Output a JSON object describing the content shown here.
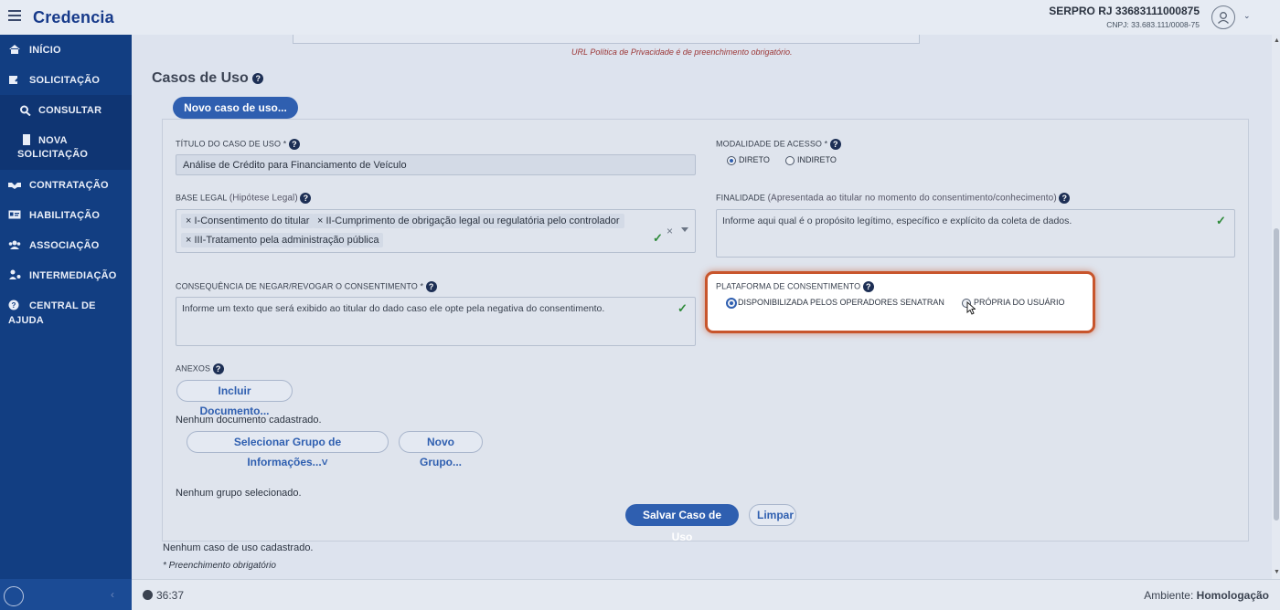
{
  "header": {
    "brand": "Credencia",
    "org_name": "SERPRO RJ 33683111000875",
    "org_cnpj": "CNPJ: 33.683.111/0008-75"
  },
  "sidebar": {
    "items": [
      {
        "label": "INÍCIO",
        "icon": "home-icon"
      },
      {
        "label": "SOLICITAÇÃO",
        "icon": "edit-icon"
      },
      {
        "label": "CONSULTAR",
        "icon": "search-icon"
      },
      {
        "label": "NOVA",
        "label2": "SOLICITAÇÃO",
        "icon": "file-icon"
      },
      {
        "label": "CONTRATAÇÃO",
        "icon": "handshake-icon"
      },
      {
        "label": "HABILITAÇÃO",
        "icon": "id-card-icon"
      },
      {
        "label": "ASSOCIAÇÃO",
        "icon": "users-icon"
      },
      {
        "label": "INTERMEDIAÇÃO",
        "icon": "person-network-icon"
      },
      {
        "label": "CENTRAL DE",
        "label2": "AJUDA",
        "icon": "help-icon"
      }
    ]
  },
  "main": {
    "privacy_url_error": "URL Política de Privacidade é de preenchimento obrigatório.",
    "section_title": "Casos de Uso",
    "new_use_case_btn": "Novo caso de uso...",
    "form": {
      "title_label": "TÍTULO DO CASO DE USO *",
      "title_value": "Análise de Crédito para Financiamento de Veículo",
      "access_label": "MODALIDADE DE ACESSO *",
      "access_options": [
        "DIRETO",
        "INDIRETO"
      ],
      "access_selected": "DIRETO",
      "legal_label": "BASE LEGAL",
      "legal_hint": "(Hipótese Legal)",
      "legal_tags": [
        "I-Consentimento do titular",
        "II-Cumprimento de obrigação legal ou regulatória pelo controlador",
        "III-Tratamento pela administração pública"
      ],
      "purpose_label": "FINALIDADE",
      "purpose_hint": "(Apresentada ao titular no momento do consentimento/conhecimento)",
      "purpose_placeholder": "Informe aqui qual é o propósito legítimo, específico e explícito da coleta de dados.",
      "consequence_label": "CONSEQUÊNCIA DE NEGAR/REVOGAR O CONSENTIMENTO *",
      "consequence_placeholder": "Informe um texto que será exibido ao titular do dado caso ele opte pela negativa do consentimento.",
      "platform_label": "PLATAFORMA DE CONSENTIMENTO",
      "platform_options": [
        "DISPONIBILIZADA PELOS OPERADORES SENATRAN",
        "PRÓPRIA DO USUÁRIO"
      ],
      "platform_selected": "DISPONIBILIZADA PELOS OPERADORES SENATRAN",
      "attachments_label": "ANEXOS",
      "include_doc_btn": "Incluir Documento...",
      "no_doc_text": "Nenhum documento cadastrado.",
      "select_group_btn": "Selecionar Grupo de Informações...",
      "new_group_btn": "Novo Grupo...",
      "no_group_text": "Nenhum grupo selecionado.",
      "save_btn": "Salvar Caso de Uso",
      "clear_btn": "Limpar"
    },
    "no_use_case_text": "Nenhum caso de uso cadastrado.",
    "required_note": "* Preenchimento obrigatório"
  },
  "footer": {
    "timer": "36:37",
    "env_label": "Ambiente:",
    "env_value": "Homologação"
  },
  "colors": {
    "sidebar": "#123e82",
    "brand": "#173a8a",
    "primary_button": "#2f5fb0",
    "highlight_border": "#c8552c",
    "valid_check": "#2e8a3a"
  }
}
